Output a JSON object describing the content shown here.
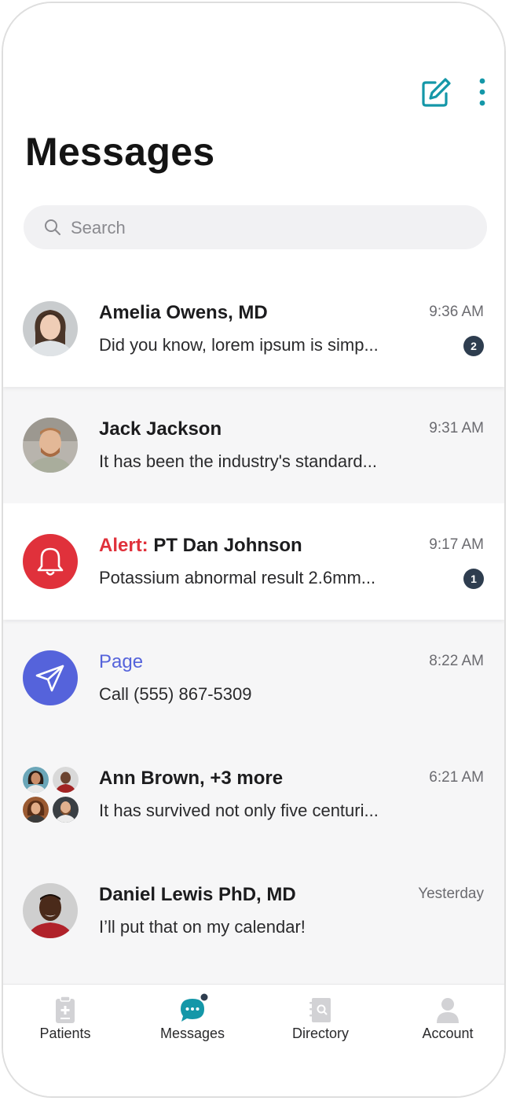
{
  "header": {
    "title": "Messages",
    "compose_icon": "compose-icon",
    "menu_icon": "more-vertical-icon",
    "accent_color": "#1497a8"
  },
  "search": {
    "placeholder": "Search",
    "value": ""
  },
  "conversations": [
    {
      "name": "Amelia Owens, MD",
      "preview": "Did you know, lorem ipsum is simp...",
      "time": "9:36 AM",
      "badge": "2"
    },
    {
      "name": "Jack Jackson",
      "preview": "It has been the industry's standard...",
      "time": "9:31 AM"
    },
    {
      "alert_prefix": "Alert:",
      "name": "PT Dan Johnson",
      "preview": "Potassium abnormal result 2.6mm...",
      "time": "9:17 AM",
      "badge": "1",
      "alert_color": "#e0313b"
    },
    {
      "name": "Page",
      "preview": "Call (555) 867-5309",
      "time": "8:22 AM",
      "page_color": "#5563db"
    },
    {
      "name": "Ann Brown, +3 more",
      "preview": "It has survived not only five centuri...",
      "time": "6:21 AM"
    },
    {
      "name": "Daniel Lewis PhD, MD",
      "preview": "I’ll put that on my calendar!",
      "time": "Yesterday"
    }
  ],
  "tabbar": {
    "tabs": [
      {
        "label": "Patients",
        "icon": "clipboard-icon"
      },
      {
        "label": "Messages",
        "icon": "chat-bubble-icon",
        "active": true
      },
      {
        "label": "Directory",
        "icon": "directory-book-icon"
      },
      {
        "label": "Account",
        "icon": "person-icon"
      }
    ]
  }
}
